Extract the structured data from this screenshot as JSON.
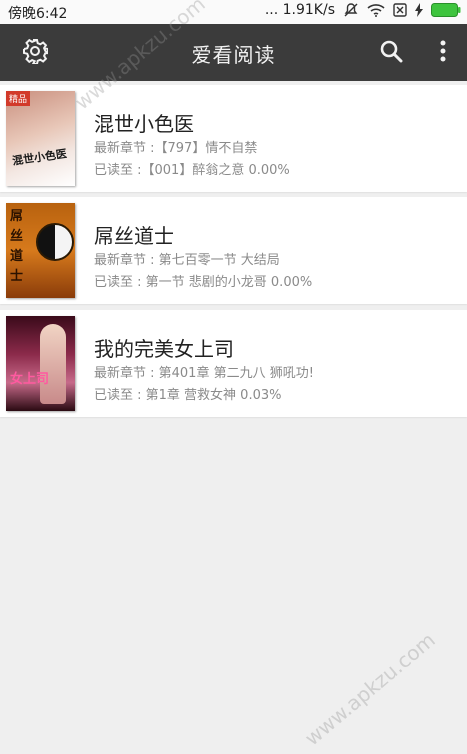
{
  "status": {
    "time": "傍晚6:42",
    "network_speed": "... 1.91K/s"
  },
  "appbar": {
    "title": "爱看阅读"
  },
  "books": [
    {
      "title": "混世小色医",
      "latest": "最新章节 :【797】情不自禁",
      "read": "已读至 :【001】醉翁之意 0.00%",
      "cover_badge": "精品",
      "cover_text": "混世小色医"
    },
    {
      "title": "屌丝道士",
      "latest": "最新章节 : 第七百零一节 大结局",
      "read": "已读至 : 第一节 悲剧的小龙哥 0.00%",
      "cover_text": "屌丝道士"
    },
    {
      "title": "我的完美女上司",
      "latest": "最新章节 : 第401章 第二九八 狮吼功!",
      "read": "已读至 : 第1章 营救女神 0.03%",
      "cover_text": "女上司"
    }
  ],
  "watermarks": [
    "www.apkzu.com",
    "www.apkzu.com"
  ],
  "icons": [
    "settings-icon",
    "search-icon",
    "more-vert-icon",
    "mute-icon",
    "wifi-icon",
    "sim-icon",
    "charging-icon",
    "battery-icon"
  ]
}
